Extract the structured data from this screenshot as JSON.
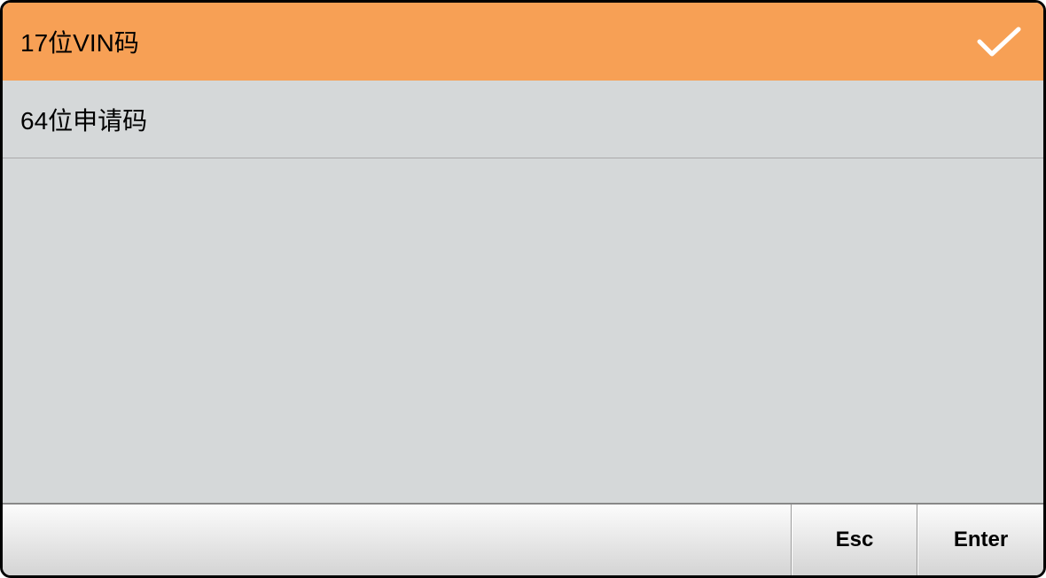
{
  "list": {
    "items": [
      {
        "label": "17位VIN码",
        "selected": true
      },
      {
        "label": "64位申请码",
        "selected": false
      }
    ]
  },
  "buttons": {
    "esc": "Esc",
    "enter": "Enter"
  }
}
